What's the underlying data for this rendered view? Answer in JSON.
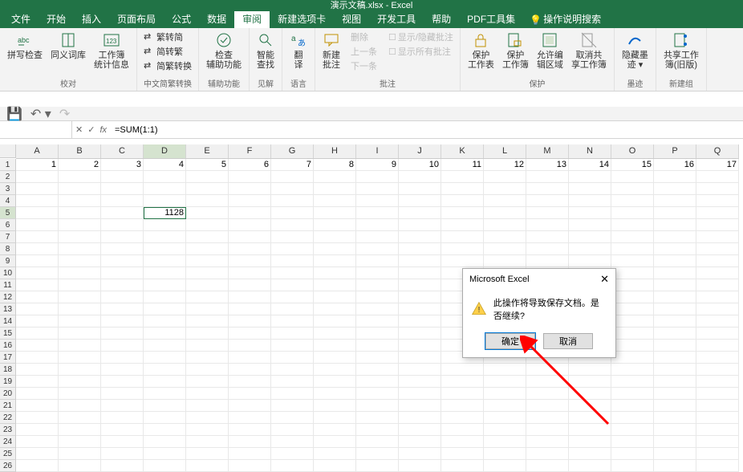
{
  "title": "演示文稿.xlsx - Excel",
  "menu": [
    "文件",
    "开始",
    "插入",
    "页面布局",
    "公式",
    "数据",
    "审阅",
    "新建选项卡",
    "视图",
    "开发工具",
    "帮助",
    "PDF工具集"
  ],
  "menu_active_index": 6,
  "tell_me": "操作说明搜索",
  "ribbon": {
    "groups": [
      {
        "label": "校对",
        "big": [
          {
            "name": "拼写检查",
            "icon": "abc"
          },
          {
            "name": "同义词库",
            "icon": "book"
          },
          {
            "name": "工作簿\n统计信息",
            "icon": "123"
          }
        ]
      },
      {
        "label": "中文简繁转换",
        "small": [
          "繁转简",
          "简转繁",
          "简繁转换"
        ]
      },
      {
        "label": "辅助功能",
        "big": [
          {
            "name": "检查\n辅助功能",
            "icon": "check"
          }
        ]
      },
      {
        "label": "见解",
        "big": [
          {
            "name": "智能\n查找",
            "icon": "search"
          }
        ]
      },
      {
        "label": "语言",
        "big": [
          {
            "name": "翻\n译",
            "icon": "translate"
          }
        ]
      },
      {
        "label": "批注",
        "big": [
          {
            "name": "新建\n批注",
            "icon": "comment"
          }
        ],
        "small_disabled": [
          "删除",
          "上一条",
          "下一条"
        ],
        "checks": [
          "显示/隐藏批注",
          "显示所有批注"
        ]
      },
      {
        "label": "保护",
        "big": [
          {
            "name": "保护\n工作表",
            "icon": "lock"
          },
          {
            "name": "保护\n工作簿",
            "icon": "lockbook"
          },
          {
            "name": "允许编\n辑区域",
            "icon": "editrange"
          },
          {
            "name": "取消共\n享工作簿",
            "icon": "unshare"
          }
        ]
      },
      {
        "label": "墨迹",
        "big": [
          {
            "name": "隐藏墨\n迹 ▾",
            "icon": "ink"
          }
        ]
      },
      {
        "label": "新建组",
        "big": [
          {
            "name": "共享工作\n簿(旧版)",
            "icon": "share"
          }
        ]
      }
    ]
  },
  "name_box": "",
  "formula": "=SUM(1:1)",
  "columns": [
    "A",
    "B",
    "C",
    "D",
    "E",
    "F",
    "G",
    "H",
    "I",
    "J",
    "K",
    "L",
    "M",
    "N",
    "O",
    "P",
    "Q"
  ],
  "row_count": 26,
  "selected_cell": {
    "row": 5,
    "col": "D"
  },
  "row1_values": {
    "A": "1",
    "B": "2",
    "C": "3",
    "D": "4",
    "E": "5",
    "F": "6",
    "G": "7",
    "H": "8",
    "I": "9",
    "J": "10",
    "K": "11",
    "L": "12",
    "M": "13",
    "N": "14",
    "O": "15",
    "P": "16",
    "Q": "17"
  },
  "d5_value": "1128",
  "dialog": {
    "title": "Microsoft Excel",
    "message": "此操作将导致保存文档。是否继续?",
    "ok": "确定",
    "cancel": "取消"
  },
  "qat": {
    "save": "保存",
    "undo": "撤销",
    "redo": "重做"
  }
}
